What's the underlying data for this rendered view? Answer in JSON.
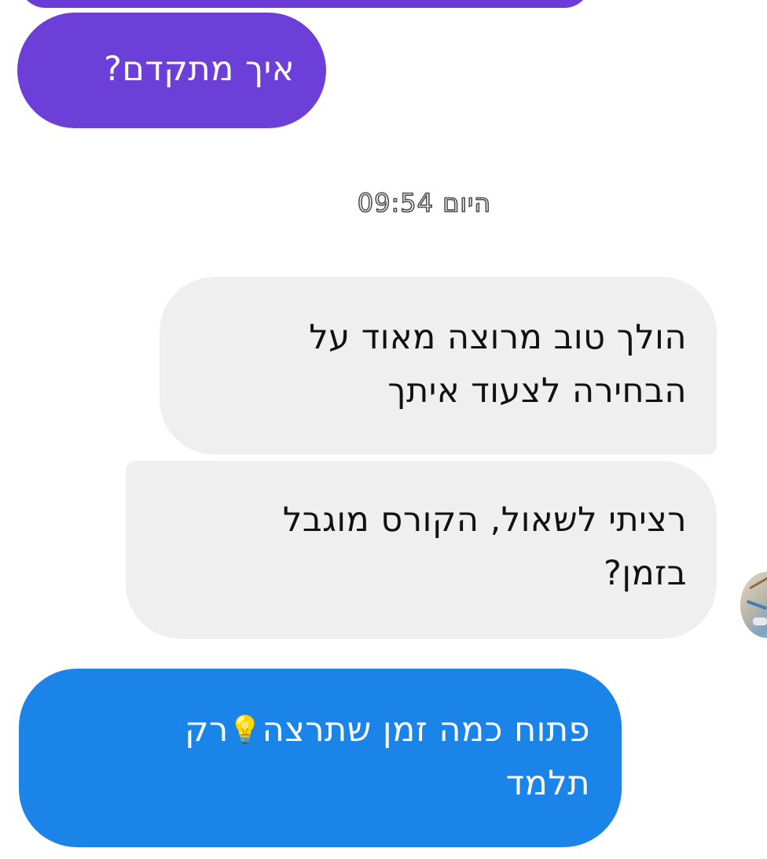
{
  "conversation": {
    "previous_sent": {
      "text": "איך מתקדם?",
      "color": "#6c3fd9"
    },
    "timestamp": "היום 09:54",
    "received": [
      {
        "lines": [
          "הולך טוב מרוצה מאוד על",
          "הבחירה לצעוד איתך"
        ]
      },
      {
        "lines": [
          "רציתי לשאול, הקורס מוגבל",
          "בזמן?"
        ]
      }
    ],
    "reply_sent": {
      "line1_part1": "פתוח כמה זמן שתרצה",
      "line1_part2": "רק",
      "line2": "תלמד",
      "emoji_icon": "light-bulb-icon",
      "color": "#1b84e8"
    },
    "avatar_icon": "avatar"
  }
}
